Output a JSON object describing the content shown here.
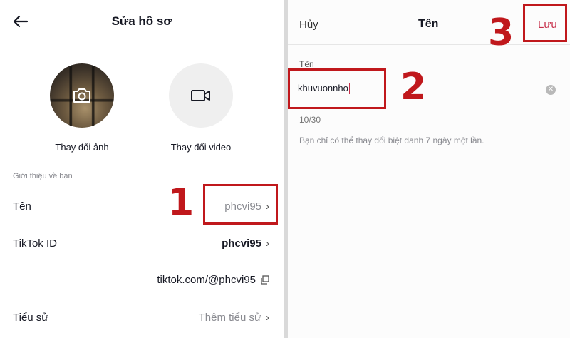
{
  "left": {
    "title": "Sửa hồ sơ",
    "change_photo": "Thay đổi ảnh",
    "change_video": "Thay đổi video",
    "section_label": "Giới thiệu về bạn",
    "rows": [
      {
        "label": "Tên",
        "value": "phcvi95"
      },
      {
        "label": "TikTok ID",
        "value": "phcvi95"
      },
      {
        "label": "",
        "value": "tiktok.com/@phcvi95"
      },
      {
        "label": "Tiểu sử",
        "value": "Thêm tiểu sử"
      }
    ]
  },
  "right": {
    "cancel": "Hủy",
    "title": "Tên",
    "save": "Lưu",
    "field_label": "Tên",
    "field_value": "khuvuonnho",
    "char_count": "10/30",
    "note": "Bạn chỉ có thể thay đổi biệt danh 7 ngày một lần."
  },
  "annotations": {
    "step1": "1",
    "step2": "2",
    "step3": "3",
    "highlight_color": "#c0181c"
  },
  "colors": {
    "accent": "#c7304b",
    "muted": "#8a8b91"
  },
  "icons": [
    "back-arrow-icon",
    "camera-icon",
    "video-camera-icon",
    "chevron-right-icon",
    "copy-icon",
    "clear-icon"
  ]
}
